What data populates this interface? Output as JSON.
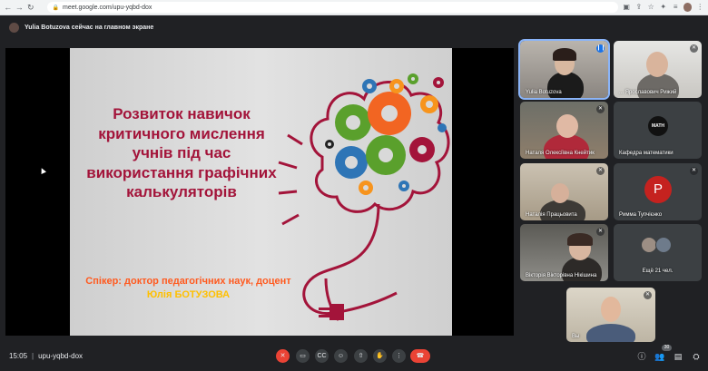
{
  "browser": {
    "url": "meet.google.com/upu-yqbd-dox"
  },
  "banner": {
    "text": "Yulia Botuzova сейчас на главном экране"
  },
  "slide": {
    "title": "Розвиток навичок критичного мислення учнів під час використання графічних калькуляторів",
    "speaker_prefix": "Спікер: доктор педагогічних наук, доцент ",
    "speaker_name": "Юлія БОТУЗОВА"
  },
  "tiles": [
    {
      "name": "Yulia Botuzova",
      "speaking": true
    },
    {
      "name": "... Ярославович Рижий"
    },
    {
      "name": "Наталя Олексіївна Кнейтик"
    },
    {
      "name": "Кафедра математики",
      "logo_text": "MATH"
    },
    {
      "name": "Наталія Працьовита"
    },
    {
      "name": "Римма Тупчієнко",
      "avatar_letter": "Р"
    },
    {
      "name": "Вікторія Вікторівна Нікішина"
    },
    {
      "name": "Ещё 21 чел."
    },
    {
      "name": "Вы"
    }
  ],
  "bottom": {
    "time": "15:05",
    "meeting_code": "upu-yqbd-dox",
    "participants_count": "30"
  },
  "colors": {
    "slide_title": "#a3143a",
    "speaker_text": "#ff5a1f",
    "speaker_highlight": "#ffc000",
    "end_call": "#ea4335",
    "background": "#202124"
  }
}
